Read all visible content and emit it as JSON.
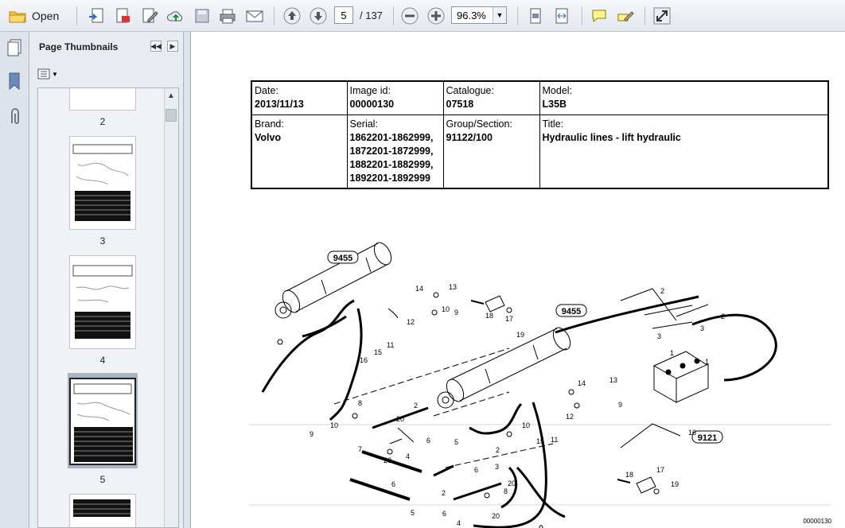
{
  "toolbar": {
    "open_label": "Open",
    "current_page": "5",
    "page_total": "/ 137",
    "zoom": "96.3%"
  },
  "panel": {
    "title": "Page Thumbnails",
    "pages": [
      {
        "label": "2"
      },
      {
        "label": "3"
      },
      {
        "label": "4"
      },
      {
        "label": "5",
        "selected": true
      }
    ]
  },
  "document": {
    "header": {
      "date_label": "Date:",
      "date": "2013/11/13",
      "image_id_label": "Image id:",
      "image_id": "00000130",
      "catalogue_label": "Catalogue:",
      "catalogue": "07518",
      "model_label": "Model:",
      "model": "L35B",
      "brand_label": "Brand:",
      "brand": "Volvo",
      "serial_label": "Serial:",
      "serials": [
        "1862201-1862999,",
        "1872201-1872999,",
        "1882201-1882999,",
        "1892201-1892999"
      ],
      "group_label": "Group/Section:",
      "group": "91122/100",
      "title_label": "Title:",
      "title": "Hydraulic lines - lift hydraulic"
    },
    "diagram": {
      "callout_boxes": [
        "9455",
        "9455",
        "9121"
      ],
      "part_numbers": [
        "1",
        "1",
        "2",
        "2",
        "2",
        "2",
        "2",
        "3",
        "3",
        "3",
        "4",
        "4",
        "5",
        "5",
        "6",
        "6",
        "6",
        "6",
        "7",
        "7",
        "8",
        "8",
        "9",
        "9",
        "9",
        "9",
        "10",
        "10",
        "10",
        "10",
        "11",
        "11",
        "12",
        "12",
        "13",
        "13",
        "14",
        "14",
        "15",
        "15",
        "16",
        "16",
        "17",
        "17",
        "18",
        "18",
        "19",
        "19",
        "20",
        "20",
        "20",
        "20"
      ],
      "image_code": "00000130"
    }
  },
  "colors": {
    "toolbar_bg": "#e9edf2",
    "panel_bg": "#e8ecf1",
    "selection": "#a8b4c4",
    "ink": "#000000"
  }
}
